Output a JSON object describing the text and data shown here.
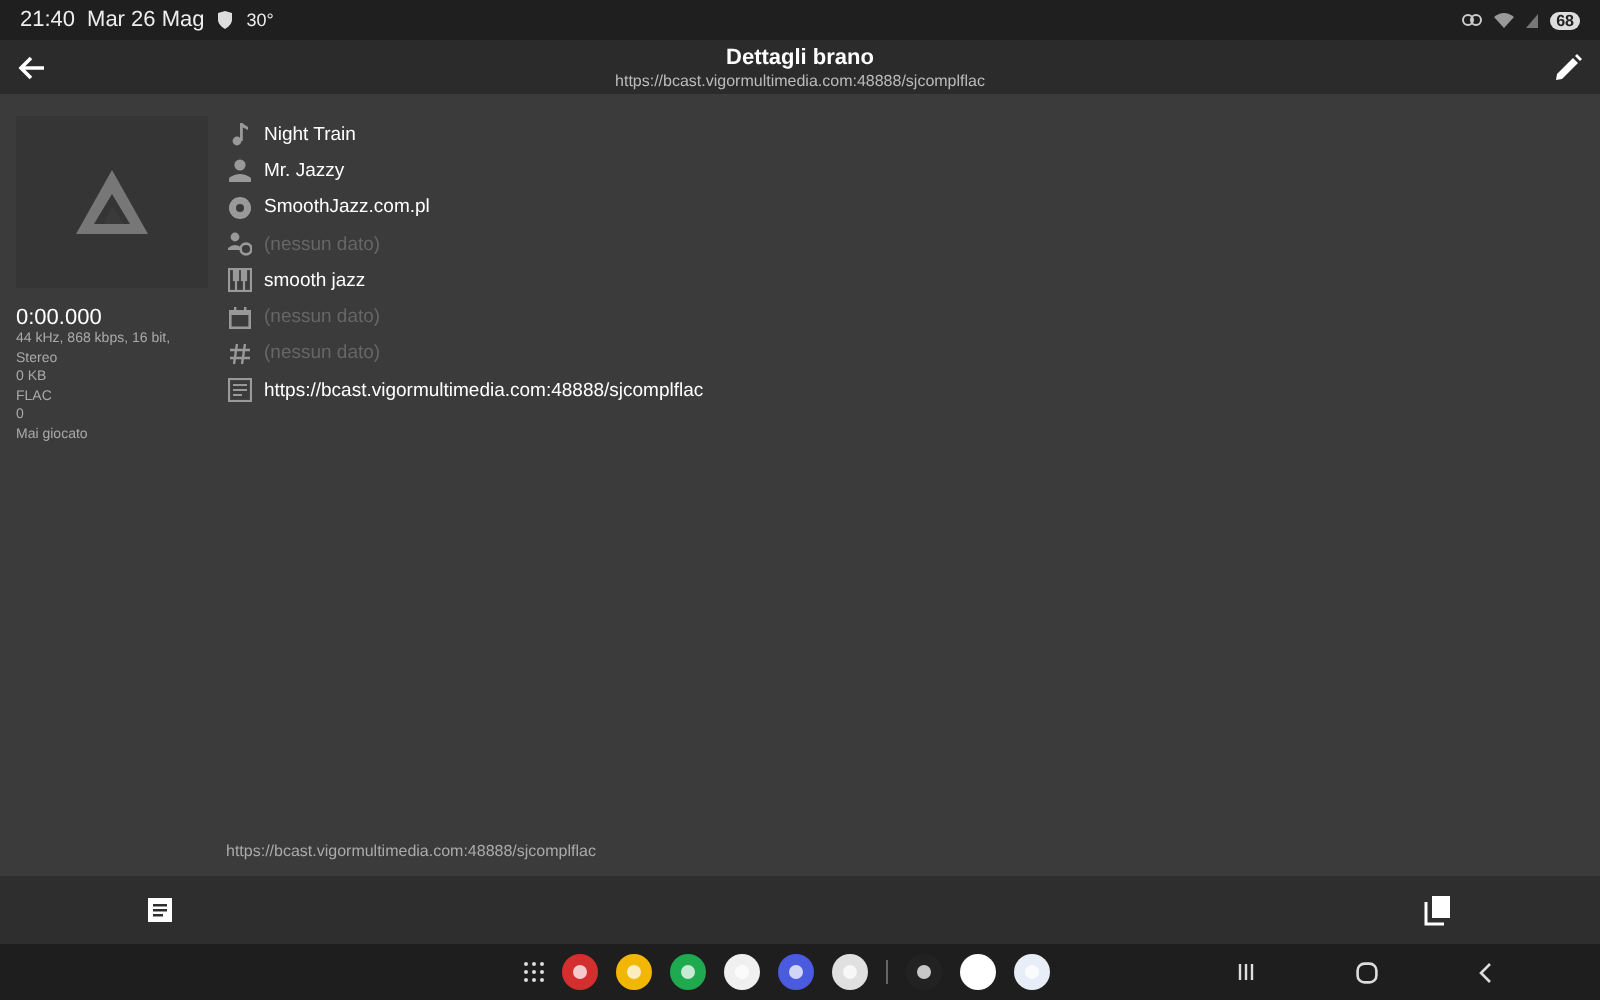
{
  "status_bar": {
    "time": "21:40",
    "date": "Mar 26 Mag",
    "temperature": "30°",
    "battery": "68"
  },
  "app_bar": {
    "title": "Dettagli brano",
    "subtitle": "https://bcast.vigormultimedia.com:48888/sjcomplflac"
  },
  "track_info": {
    "duration": "0:00.000",
    "lines": [
      "44 kHz, 868 kbps, 16 bit, Stereo",
      "0 KB",
      "FLAC",
      "0",
      "Mai giocato"
    ]
  },
  "fields": [
    {
      "kind": "title",
      "value": "Night Train",
      "empty": false
    },
    {
      "kind": "artist",
      "value": "Mr. Jazzy",
      "empty": false
    },
    {
      "kind": "album",
      "value": "SmoothJazz.com.pl",
      "empty": false
    },
    {
      "kind": "composer",
      "value": "(nessun dato)",
      "empty": true
    },
    {
      "kind": "genre",
      "value": "smooth jazz",
      "empty": false
    },
    {
      "kind": "year",
      "value": "(nessun dato)",
      "empty": true
    },
    {
      "kind": "number",
      "value": "(nessun dato)",
      "empty": true
    },
    {
      "kind": "path",
      "value": "https://bcast.vigormultimedia.com:48888/sjcomplflac",
      "empty": false
    }
  ],
  "footer_path": "https://bcast.vigormultimedia.com:48888/sjcomplflac",
  "dock": [
    {
      "color": "#d32f2f"
    },
    {
      "color": "#f2b705"
    },
    {
      "color": "#1faa4f"
    },
    {
      "color": "#f0f0f0"
    },
    {
      "color": "#4a5be0"
    },
    {
      "color": "#e0e0e0"
    },
    {
      "color": "#222222"
    },
    {
      "color": "#ffffff"
    },
    {
      "color": "#e8eef8"
    }
  ]
}
